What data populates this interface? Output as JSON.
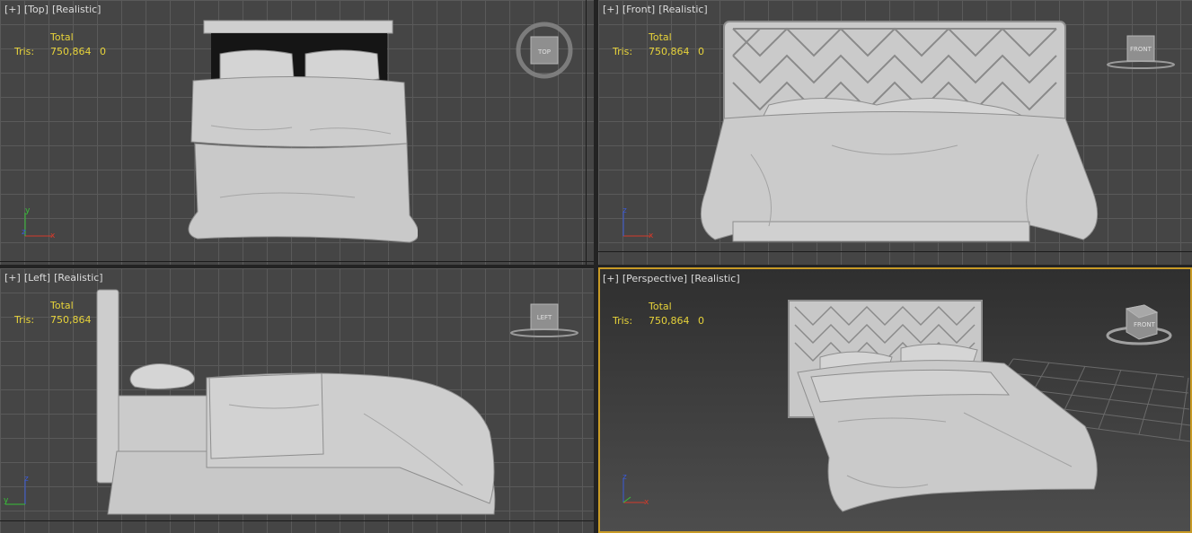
{
  "viewports": {
    "top": {
      "bracket": "[+]",
      "view": "[Top]",
      "shading": "[Realistic]"
    },
    "front": {
      "bracket": "[+]",
      "view": "[Front]",
      "shading": "[Realistic]"
    },
    "left": {
      "bracket": "[+]",
      "view": "[Left]",
      "shading": "[Realistic]"
    },
    "persp": {
      "bracket": "[+]",
      "view": "[Perspective]",
      "shading": "[Realistic]"
    }
  },
  "stats": {
    "total_label": "Total",
    "tris_label": "Tris:",
    "tris_value": "750,864",
    "tris_selected": "0"
  },
  "navcube": {
    "top": "TOP",
    "front": "FRONT",
    "left": "LEFT",
    "persp": "FRONT"
  },
  "axes": {
    "x": "x",
    "y": "y",
    "z": "z"
  },
  "colors": {
    "stats_text": "#e7d33a",
    "active_border": "#c79a26",
    "axis_x": "#d43a2a",
    "axis_y": "#38c038",
    "axis_z": "#3a5ad8"
  }
}
